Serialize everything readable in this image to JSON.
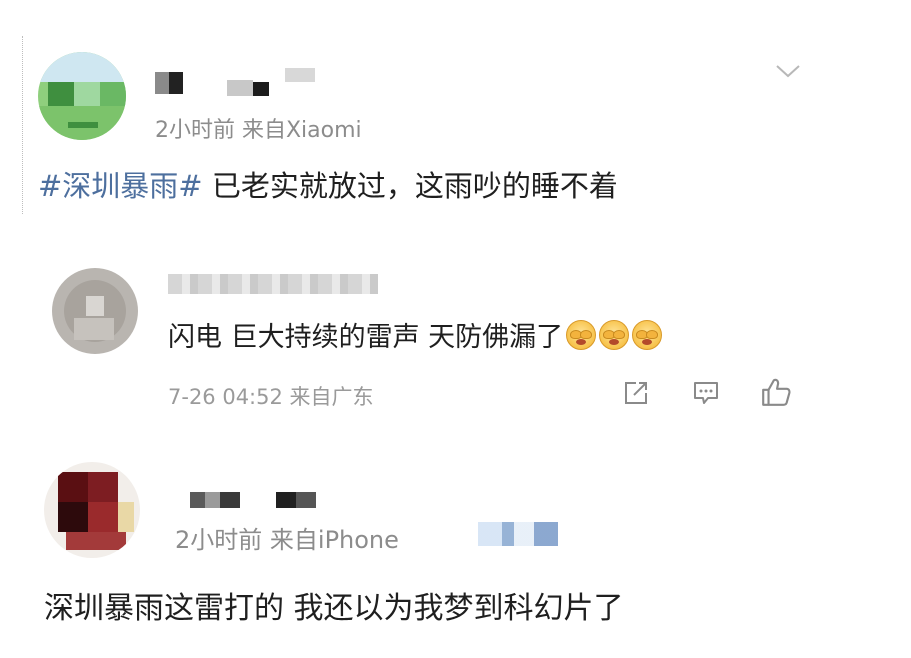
{
  "posts": [
    {
      "meta": "2小时前  来自Xiaomi",
      "topic": "#深圳暴雨#",
      "text": " 已老实就放过，这雨吵的睡不着"
    },
    {
      "meta": "7-26 04:52 来自广东",
      "text": "闪电 巨大持续的雷声 天防佛漏了",
      "emoji_names": [
        "cover-eyes-emoji",
        "cover-eyes-emoji",
        "cover-eyes-emoji"
      ]
    },
    {
      "meta": "2小时前  来自iPhone",
      "text": "深圳暴雨这雷打的 我还以为我梦到科幻片了"
    }
  ],
  "icons": {
    "expand": "chevron-down-icon",
    "share": "share-icon",
    "comment": "comment-icon",
    "like": "thumbs-up-icon"
  },
  "colors": {
    "topic": "#4d6f9e",
    "meta": "#8c8c8c",
    "text": "#1f1f1f"
  }
}
